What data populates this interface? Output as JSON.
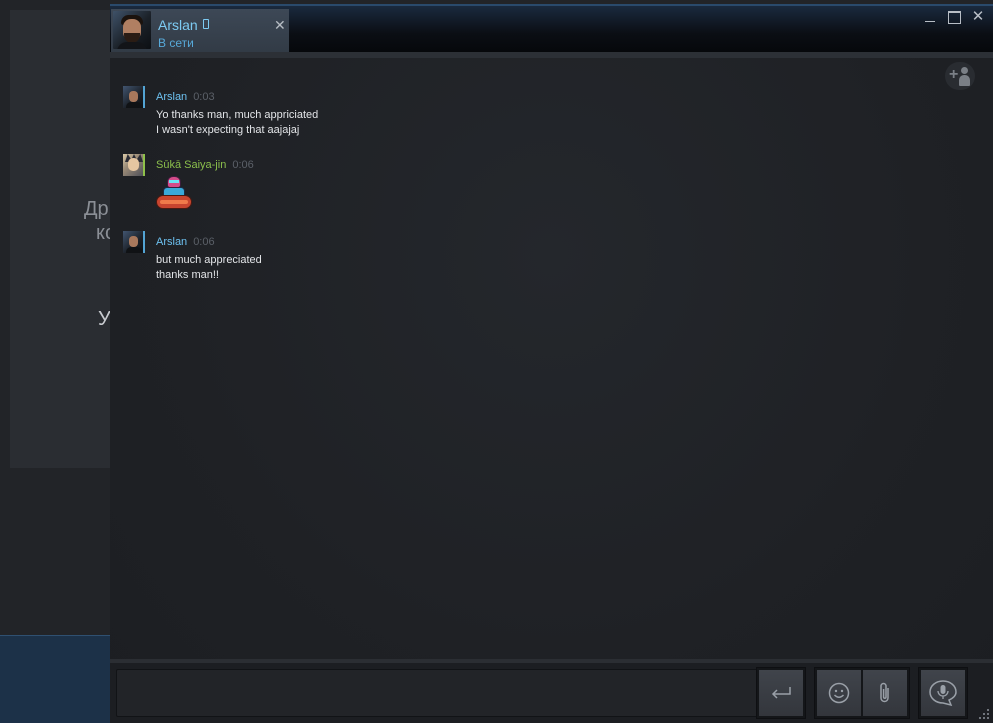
{
  "background_app": {
    "text1": "Др",
    "text2": "кс",
    "text3": "У"
  },
  "tab": {
    "name": "Arslan",
    "status": "В сети",
    "close": "✕"
  },
  "window_controls": {
    "close": "✕"
  },
  "messages": [
    {
      "sender": "Arslan",
      "time": "0:03",
      "lines": [
        "Yo thanks man, much appriciated",
        "I wasn't expecting that aajajaj"
      ]
    },
    {
      "sender": "Sūkā Saiya-jin",
      "time": "0:06",
      "lines": []
    },
    {
      "sender": "Arslan",
      "time": "0:06",
      "lines": [
        "but much appreciated",
        "thanks man!!"
      ]
    }
  ],
  "input": {
    "value": "",
    "placeholder": ""
  },
  "colors": {
    "accent": "#53a4d4",
    "online_name": "#6dc1f0",
    "ingame_name": "#8bbf4c"
  },
  "icons": [
    "mobile-icon",
    "add-friend-icon",
    "send-icon",
    "emoticon-icon",
    "attach-icon",
    "voice-icon"
  ]
}
